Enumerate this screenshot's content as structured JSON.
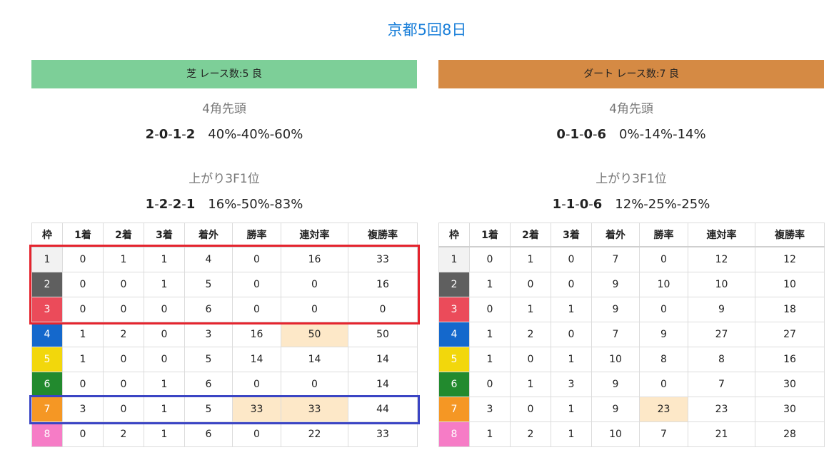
{
  "page": {
    "title": "京都5回8日"
  },
  "columns": [
    "枠",
    "1着",
    "2着",
    "3着",
    "着外",
    "勝率",
    "連対率",
    "複勝率"
  ],
  "waku_colors": [
    "#f2f2f2",
    "#5f5f5f",
    "#eb4b5a",
    "#1468cc",
    "#f2d70c",
    "#228a2e",
    "#f59724",
    "#f67cc6"
  ],
  "waku_text_colors": [
    "#333333",
    "#ffffff",
    "#ffffff",
    "#ffffff",
    "#ffffff",
    "#ffffff",
    "#ffffff",
    "#ffffff"
  ],
  "highlight_color": "#fde8c8",
  "turf": {
    "header": "芝 レース数:5 良",
    "header_color": "#7dcf98",
    "corner_label": "4角先頭",
    "corner_record": [
      "2",
      "0",
      "1",
      "2"
    ],
    "corner_rates": "40%-40%-60%",
    "last3f_label": "上がり3F1位",
    "last3f_record": [
      "1",
      "2",
      "2",
      "1"
    ],
    "last3f_rates": "16%-50%-83%",
    "rows": [
      [
        "1",
        "0",
        "1",
        "1",
        "4",
        "0",
        "16",
        "33"
      ],
      [
        "2",
        "0",
        "0",
        "1",
        "5",
        "0",
        "0",
        "16"
      ],
      [
        "3",
        "0",
        "0",
        "0",
        "6",
        "0",
        "0",
        "0"
      ],
      [
        "4",
        "1",
        "2",
        "0",
        "3",
        "16",
        "50",
        "50"
      ],
      [
        "5",
        "1",
        "0",
        "0",
        "5",
        "14",
        "14",
        "14"
      ],
      [
        "6",
        "0",
        "0",
        "1",
        "6",
        "0",
        "0",
        "14"
      ],
      [
        "7",
        "3",
        "0",
        "1",
        "5",
        "33",
        "33",
        "44"
      ],
      [
        "8",
        "0",
        "2",
        "1",
        "6",
        "0",
        "22",
        "33"
      ]
    ],
    "highlighted_cells": [
      [
        3,
        6
      ],
      [
        6,
        5
      ],
      [
        6,
        6
      ]
    ],
    "annotations": [
      {
        "color": "#e5242e",
        "rows": [
          1,
          3
        ]
      },
      {
        "color": "#3b45c4",
        "rows": [
          7,
          7
        ]
      }
    ]
  },
  "dirt": {
    "header": "ダート レース数:7 良",
    "header_color": "#d58a44",
    "corner_label": "4角先頭",
    "corner_record": [
      "0",
      "1",
      "0",
      "6"
    ],
    "corner_rates": "0%-14%-14%",
    "last3f_label": "上がり3F1位",
    "last3f_record": [
      "1",
      "1",
      "0",
      "6"
    ],
    "last3f_rates": "12%-25%-25%",
    "rows": [
      [
        "1",
        "0",
        "1",
        "0",
        "7",
        "0",
        "12",
        "12"
      ],
      [
        "2",
        "1",
        "0",
        "0",
        "9",
        "10",
        "10",
        "10"
      ],
      [
        "3",
        "0",
        "1",
        "1",
        "9",
        "0",
        "9",
        "18"
      ],
      [
        "4",
        "1",
        "2",
        "0",
        "7",
        "9",
        "27",
        "27"
      ],
      [
        "5",
        "1",
        "0",
        "1",
        "10",
        "8",
        "8",
        "16"
      ],
      [
        "6",
        "0",
        "1",
        "3",
        "9",
        "0",
        "7",
        "30"
      ],
      [
        "7",
        "3",
        "0",
        "1",
        "9",
        "23",
        "23",
        "30"
      ],
      [
        "8",
        "1",
        "2",
        "1",
        "10",
        "7",
        "21",
        "28"
      ]
    ],
    "highlighted_cells": [
      [
        6,
        5
      ]
    ],
    "annotations": []
  }
}
